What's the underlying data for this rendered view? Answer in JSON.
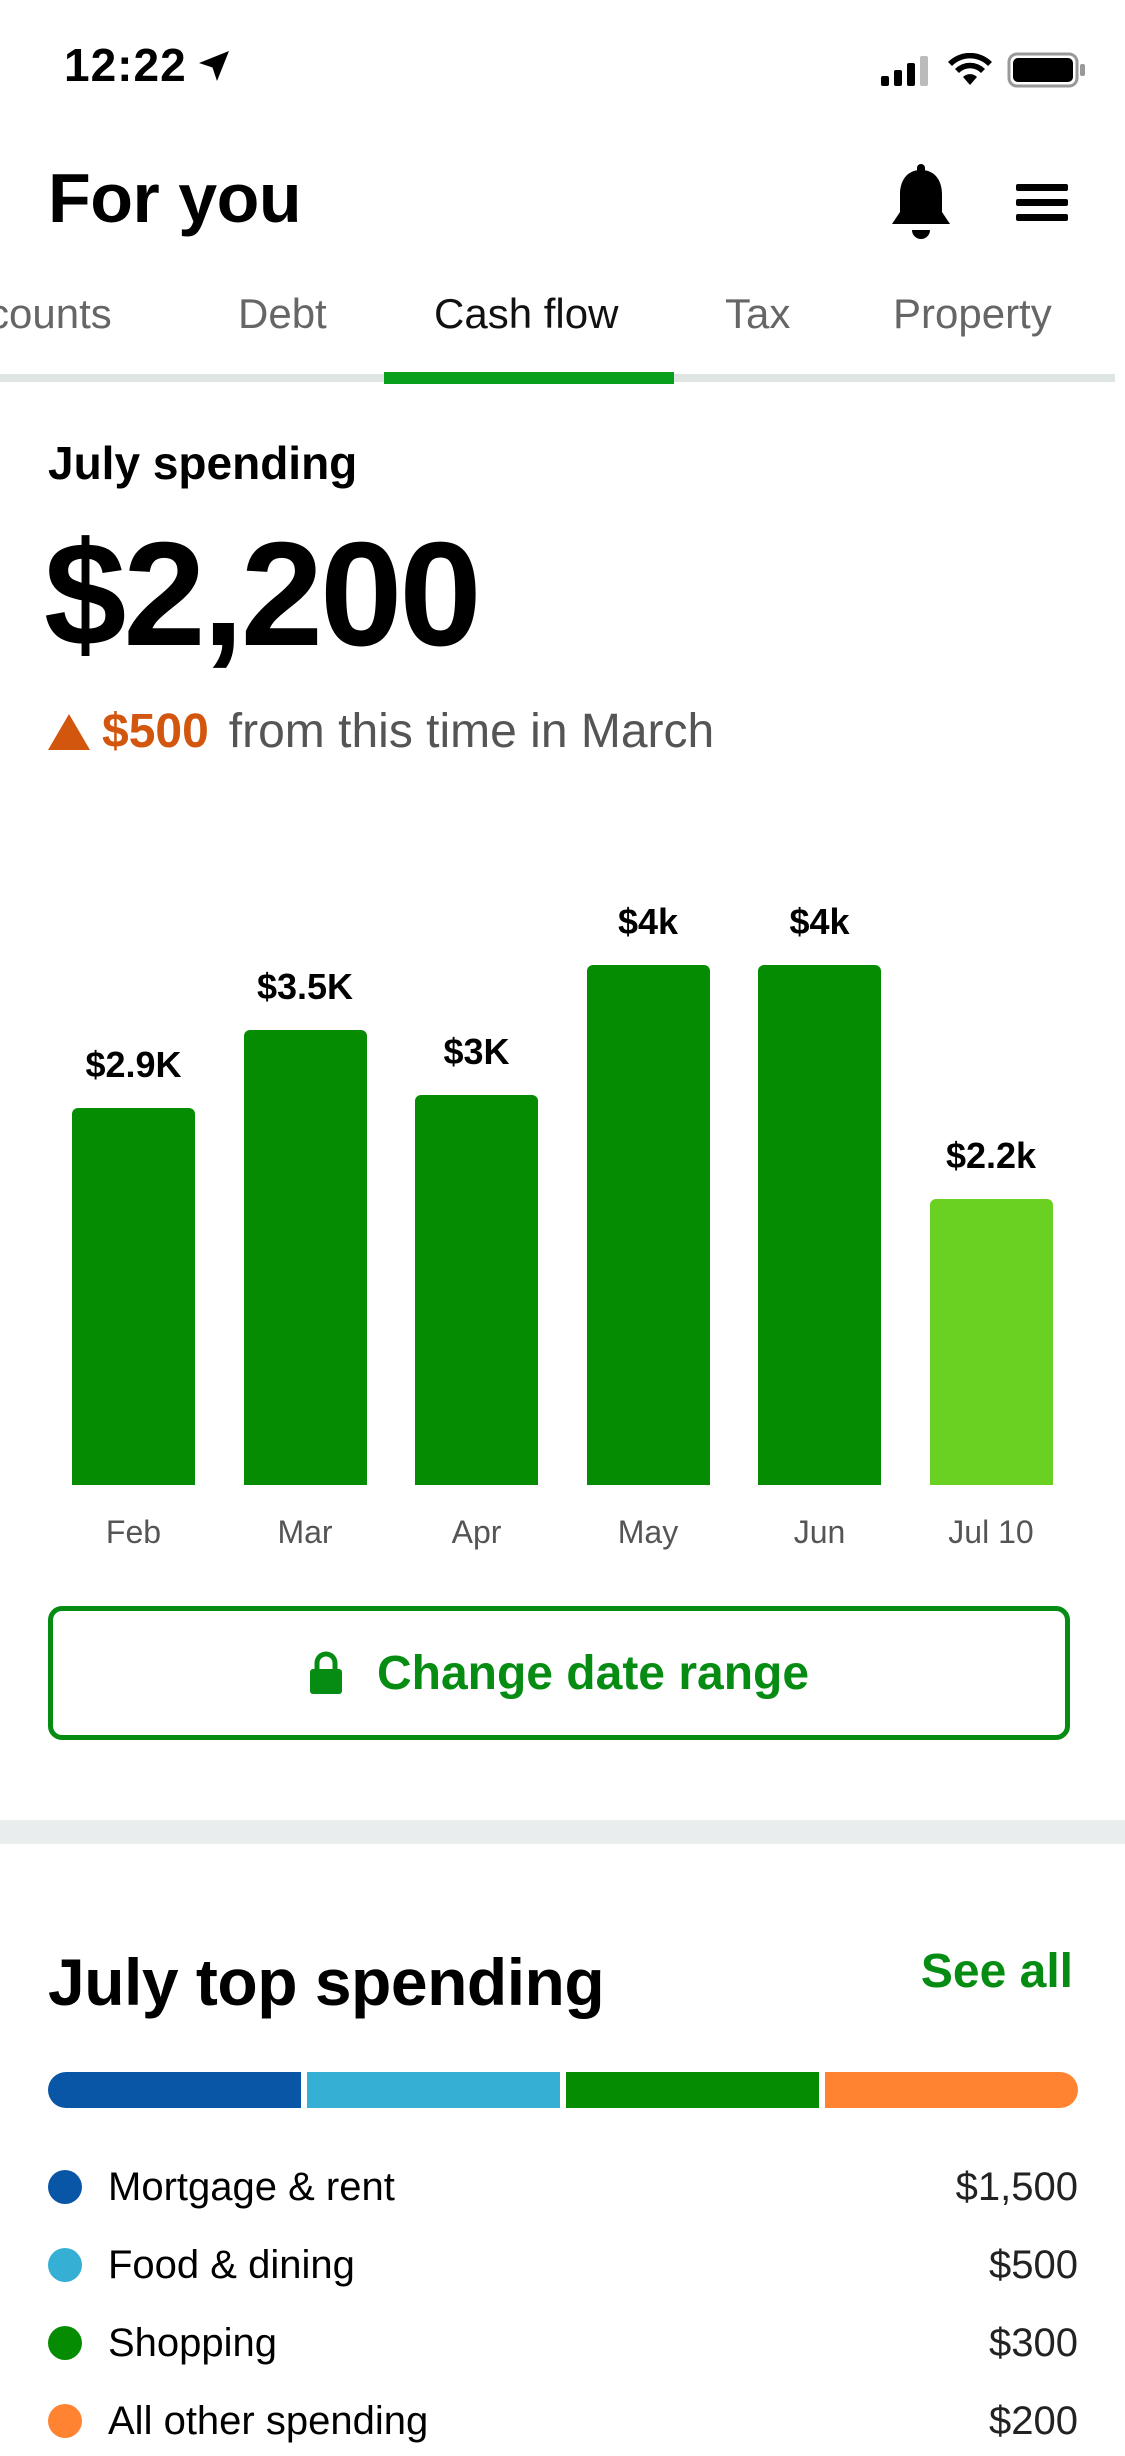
{
  "status_bar": {
    "time": "12:22"
  },
  "header": {
    "title": "For you"
  },
  "tabs": [
    {
      "label": "counts"
    },
    {
      "label": "Debt"
    },
    {
      "label": "Cash flow"
    },
    {
      "label": "Tax"
    },
    {
      "label": "Property"
    }
  ],
  "active_tab": "Cash flow",
  "summary": {
    "label": "July spending",
    "amount": "$2,200",
    "delta_value": "$500",
    "delta_text": "from this time in March",
    "delta_color": "#d2560e"
  },
  "chart_data": {
    "type": "bar",
    "categories": [
      "Feb",
      "Mar",
      "Apr",
      "May",
      "Jun",
      "Jul 10"
    ],
    "values": [
      2900,
      3500,
      3000,
      4000,
      4000,
      2200
    ],
    "data_labels": [
      "$2.9K",
      "$3.5K",
      "$3K",
      "$4k",
      "$4k",
      "$2.2k"
    ],
    "colors": [
      "#068c03",
      "#068c03",
      "#068c03",
      "#068c03",
      "#068c03",
      "#6ad122"
    ]
  },
  "date_button": {
    "label": "Change date range",
    "icon": "lock-icon"
  },
  "top_spending": {
    "title": "July top spending",
    "see_all": "See all",
    "categories": [
      {
        "name": "Mortgage & rent",
        "amount": "$1,500",
        "color": "#0a56a6"
      },
      {
        "name": "Food & dining",
        "amount": "$500",
        "color": "#35afd4"
      },
      {
        "name": "Shopping",
        "amount": "$300",
        "color": "#068c03"
      },
      {
        "name": "All other spending",
        "amount": "$200",
        "color": "#ff8330"
      }
    ]
  },
  "colors": {
    "accent": "#068c12",
    "tab_indicator": "#08a01a"
  }
}
